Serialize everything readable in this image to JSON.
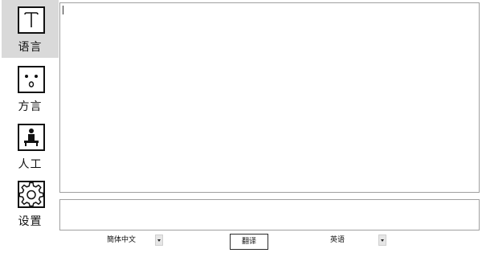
{
  "sidebar": {
    "items": [
      {
        "label": "语言",
        "icon": "text-t-icon",
        "active": true
      },
      {
        "label": "方言",
        "icon": "face-icon",
        "active": false
      },
      {
        "label": "人工",
        "icon": "person-icon",
        "active": false
      },
      {
        "label": "设置",
        "icon": "gear-icon",
        "active": false
      }
    ]
  },
  "source": {
    "text": ""
  },
  "result": {
    "text": ""
  },
  "controls": {
    "source_language": "簡体中文",
    "translate_label": "翻译",
    "target_language": "英语"
  },
  "colors": {
    "active_bg": "#d9d9d9",
    "border": "#a0a0a0",
    "text": "#111111"
  }
}
